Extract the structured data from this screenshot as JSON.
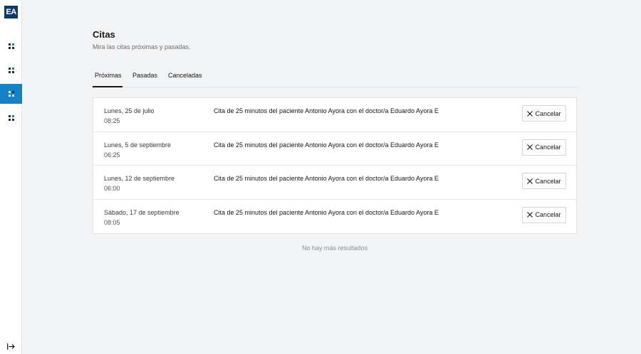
{
  "sidebar": {
    "logo": "EA",
    "items": [
      {
        "icon": "grid-icon",
        "active": false
      },
      {
        "icon": "grid-icon",
        "active": false
      },
      {
        "icon": "grid-icon",
        "active": true
      },
      {
        "icon": "grid-icon",
        "active": false
      }
    ],
    "logout_icon": "logout-icon",
    "accent_color": "#1382c9"
  },
  "header": {
    "title": "Citas",
    "subtitle": "Mira las citas próximas y pasadas."
  },
  "tabs": [
    {
      "label": "Próximas",
      "active": true
    },
    {
      "label": "Pasadas",
      "active": false
    },
    {
      "label": "Canceladas",
      "active": false
    }
  ],
  "appointments": [
    {
      "date": "Lunes, 25 de julio",
      "time": "08:25",
      "description": "Cita de 25 minutos del paciente Antonio Ayora con el doctor/a Eduardo Ayora E",
      "action": "Cancelar"
    },
    {
      "date": "Lunes, 5 de septiembre",
      "time": "06:25",
      "description": "Cita de 25 minutos del paciente Antonio Ayora con el doctor/a Eduardo Ayora E",
      "action": "Cancelar"
    },
    {
      "date": "Lunes, 12 de septiembre",
      "time": "06:00",
      "description": "Cita de 25 minutos del paciente Antonio Ayora con el doctor/a Eduardo Ayora E",
      "action": "Cancelar"
    },
    {
      "date": "Sábado, 17 de septiembre",
      "time": "08:05",
      "description": "Cita de 25 minutos del paciente Antonio Ayora con el doctor/a Eduardo Ayora E",
      "action": "Cancelar"
    }
  ],
  "footer_text": "No hay más resultados"
}
